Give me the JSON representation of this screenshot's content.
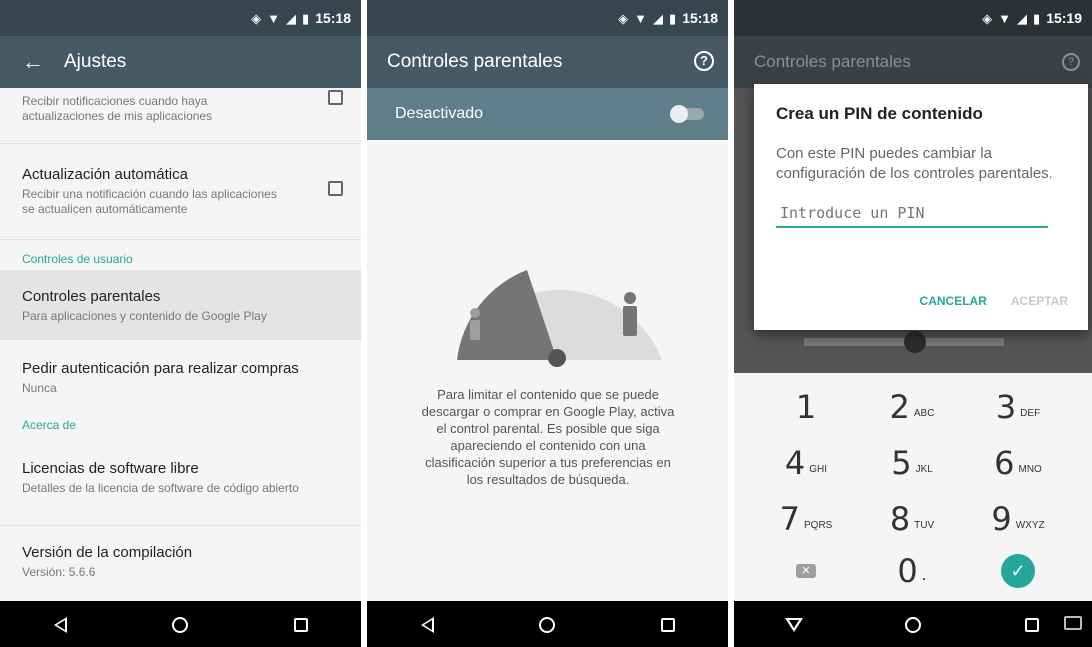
{
  "status": {
    "time_1": "15:18",
    "time_2": "15:18",
    "time_3": "15:19"
  },
  "panel1": {
    "title": "Ajustes",
    "rows": [
      {
        "sub": "Recibir notificaciones cuando haya actualizaciones de mis aplicaciones"
      },
      {
        "title": "Actualización automática",
        "sub": "Recibir una notificación cuando las aplicaciones se actualicen automáticamente"
      },
      {
        "title": "Controles parentales",
        "sub": "Para aplicaciones y contenido de Google Play"
      },
      {
        "title": "Pedir autenticación para realizar compras",
        "sub": "Nunca"
      },
      {
        "title": "Licencias de software libre",
        "sub": "Detalles de la licencia de software de código abierto"
      },
      {
        "title": "Versión de la compilación",
        "sub": "Versión: 5.6.6"
      }
    ],
    "sections": {
      "user_controls": "Controles de usuario",
      "about": "Acerca de"
    }
  },
  "panel2": {
    "title": "Controles parentales",
    "toggle_label": "Desactivado",
    "toggle_on": false,
    "description": "Para limitar el contenido que se puede descargar o comprar en Google Play, activa el control parental. Es posible que siga apareciendo el contenido con una clasificación superior a tus preferencias en los resultados de búsqueda."
  },
  "panel3": {
    "title": "Controles parentales",
    "dialog": {
      "title": "Crea un PIN de contenido",
      "body": "Con este PIN puedes cambiar la configuración de los controles parentales.",
      "placeholder": "Introduce un PIN",
      "cancel": "CANCELAR",
      "accept": "ACEPTAR"
    },
    "keys": [
      {
        "num": "1",
        "letters": ""
      },
      {
        "num": "2",
        "letters": "ABC"
      },
      {
        "num": "3",
        "letters": "DEF"
      },
      {
        "num": "4",
        "letters": "GHI"
      },
      {
        "num": "5",
        "letters": "JKL"
      },
      {
        "num": "6",
        "letters": "MNO"
      },
      {
        "num": "7",
        "letters": "PQRS"
      },
      {
        "num": "8",
        "letters": "TUV"
      },
      {
        "num": "9",
        "letters": "WXYZ"
      },
      {
        "num": "0",
        "letters": "."
      }
    ]
  },
  "colors": {
    "accent": "#26a69a",
    "appbar": "#455a64",
    "statusbar": "#37474f"
  },
  "icons": [
    "back-arrow-icon",
    "help-icon",
    "nav-back-icon",
    "nav-home-icon",
    "nav-recents-icon",
    "delete-key-icon",
    "checkmark-icon"
  ]
}
